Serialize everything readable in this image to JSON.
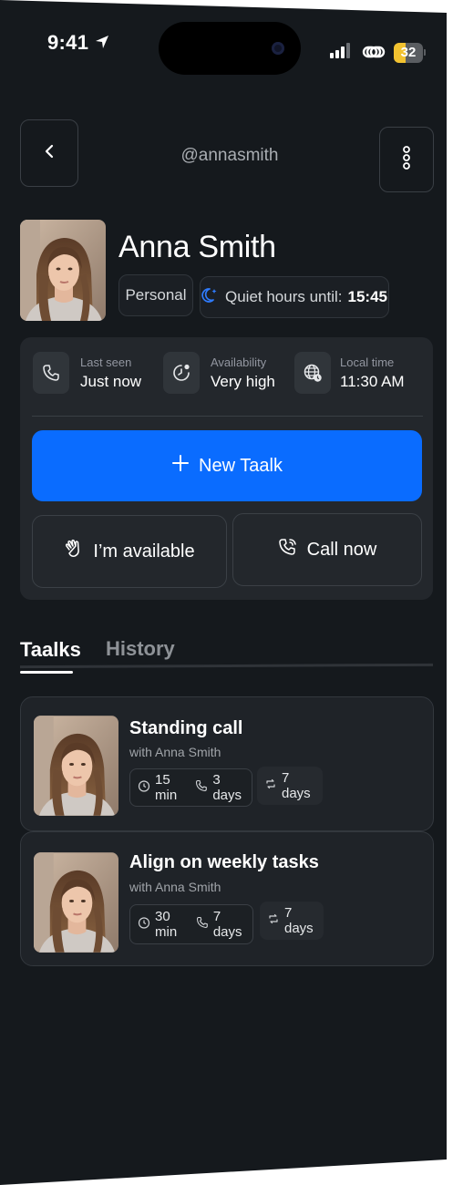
{
  "status_bar": {
    "time": "9:41",
    "battery": "32",
    "icons": [
      "location-arrow-icon",
      "signal-icon",
      "link-icon",
      "battery-icon"
    ]
  },
  "header": {
    "handle": "@annasmith",
    "back_icon": "chevron-left-icon",
    "more_icon": "more-vertical-icon"
  },
  "profile": {
    "name": "Anna Smith",
    "tag": "Personal",
    "quiet_hours_label": "Quiet hours until:",
    "quiet_hours_time": "15:45"
  },
  "info": [
    {
      "label": "Last seen",
      "value": "Just now",
      "icon": "phone-icon"
    },
    {
      "label": "Availability",
      "value": "Very high",
      "icon": "timer-icon"
    },
    {
      "label": "Local time",
      "value": "11:30 AM",
      "icon": "globe-clock-icon"
    }
  ],
  "actions": {
    "new_taalk": "New Taalk",
    "available": "I’m available",
    "call_now": "Call now"
  },
  "tabs": [
    {
      "label": "Taalks",
      "active": true
    },
    {
      "label": "History",
      "active": false
    }
  ],
  "taalks": [
    {
      "title": "Standing call",
      "with": "with Anna Smith",
      "duration": "15 min",
      "calls": "3 days",
      "repeat": "7 days"
    },
    {
      "title": "Align on weekly tasks",
      "with": "with Anna Smith",
      "duration": "30 min",
      "calls": "7 days",
      "repeat": "7 days"
    }
  ],
  "colors": {
    "accent": "#0a6cff",
    "background": "#15191d",
    "card": "#23272c",
    "battery": "#f2c230"
  }
}
